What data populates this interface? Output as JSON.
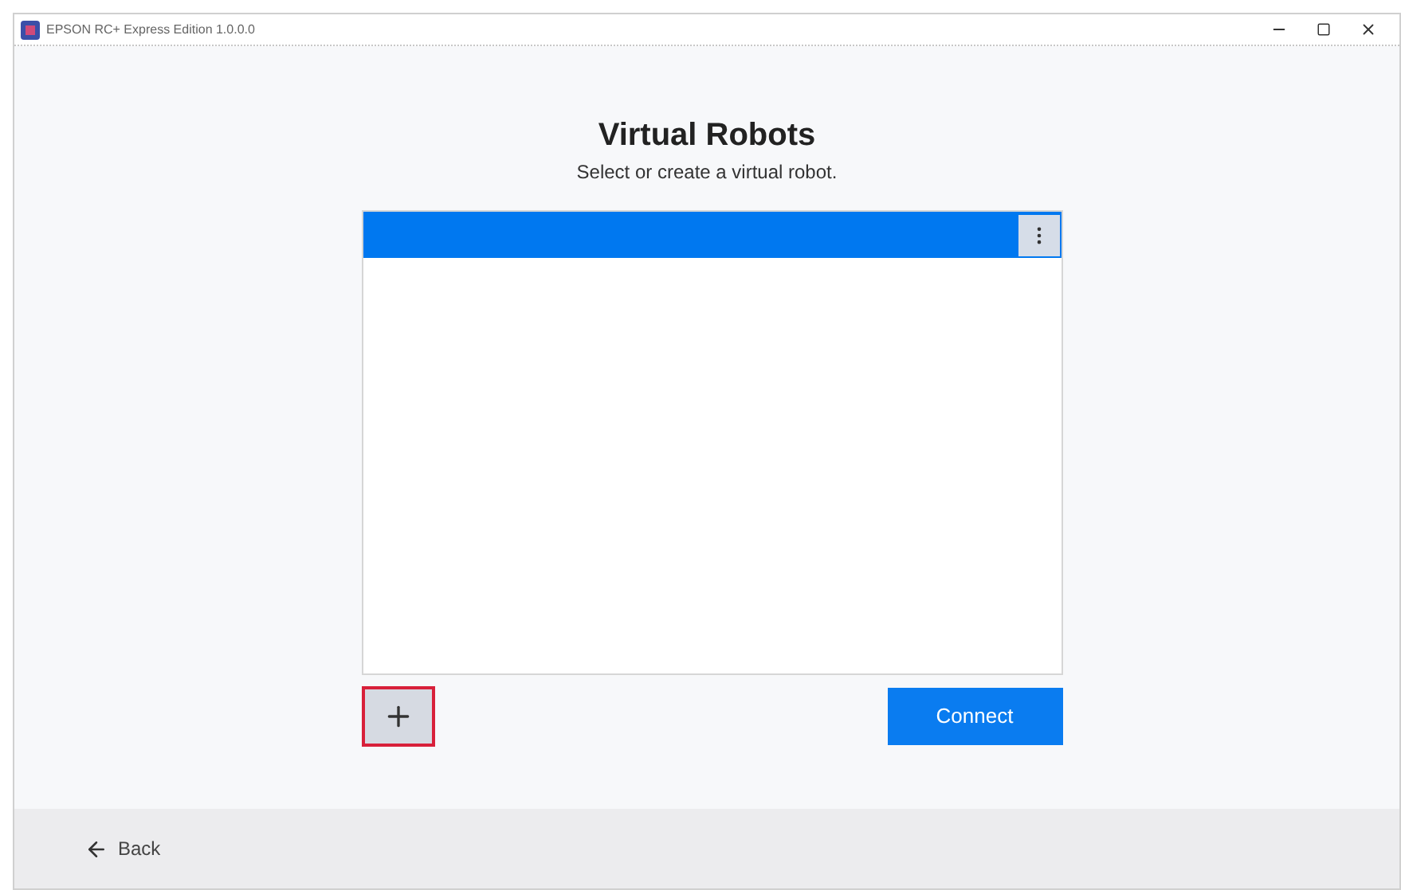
{
  "window": {
    "title": "EPSON RC+ Express Edition 1.0.0.0"
  },
  "heading": "Virtual Robots",
  "subtitle": "Select or create a virtual robot.",
  "robots": [
    {
      "selected": true
    }
  ],
  "add_button": {
    "highlighted": true
  },
  "connect_button": {
    "label": "Connect"
  },
  "footer": {
    "back_label": "Back"
  }
}
